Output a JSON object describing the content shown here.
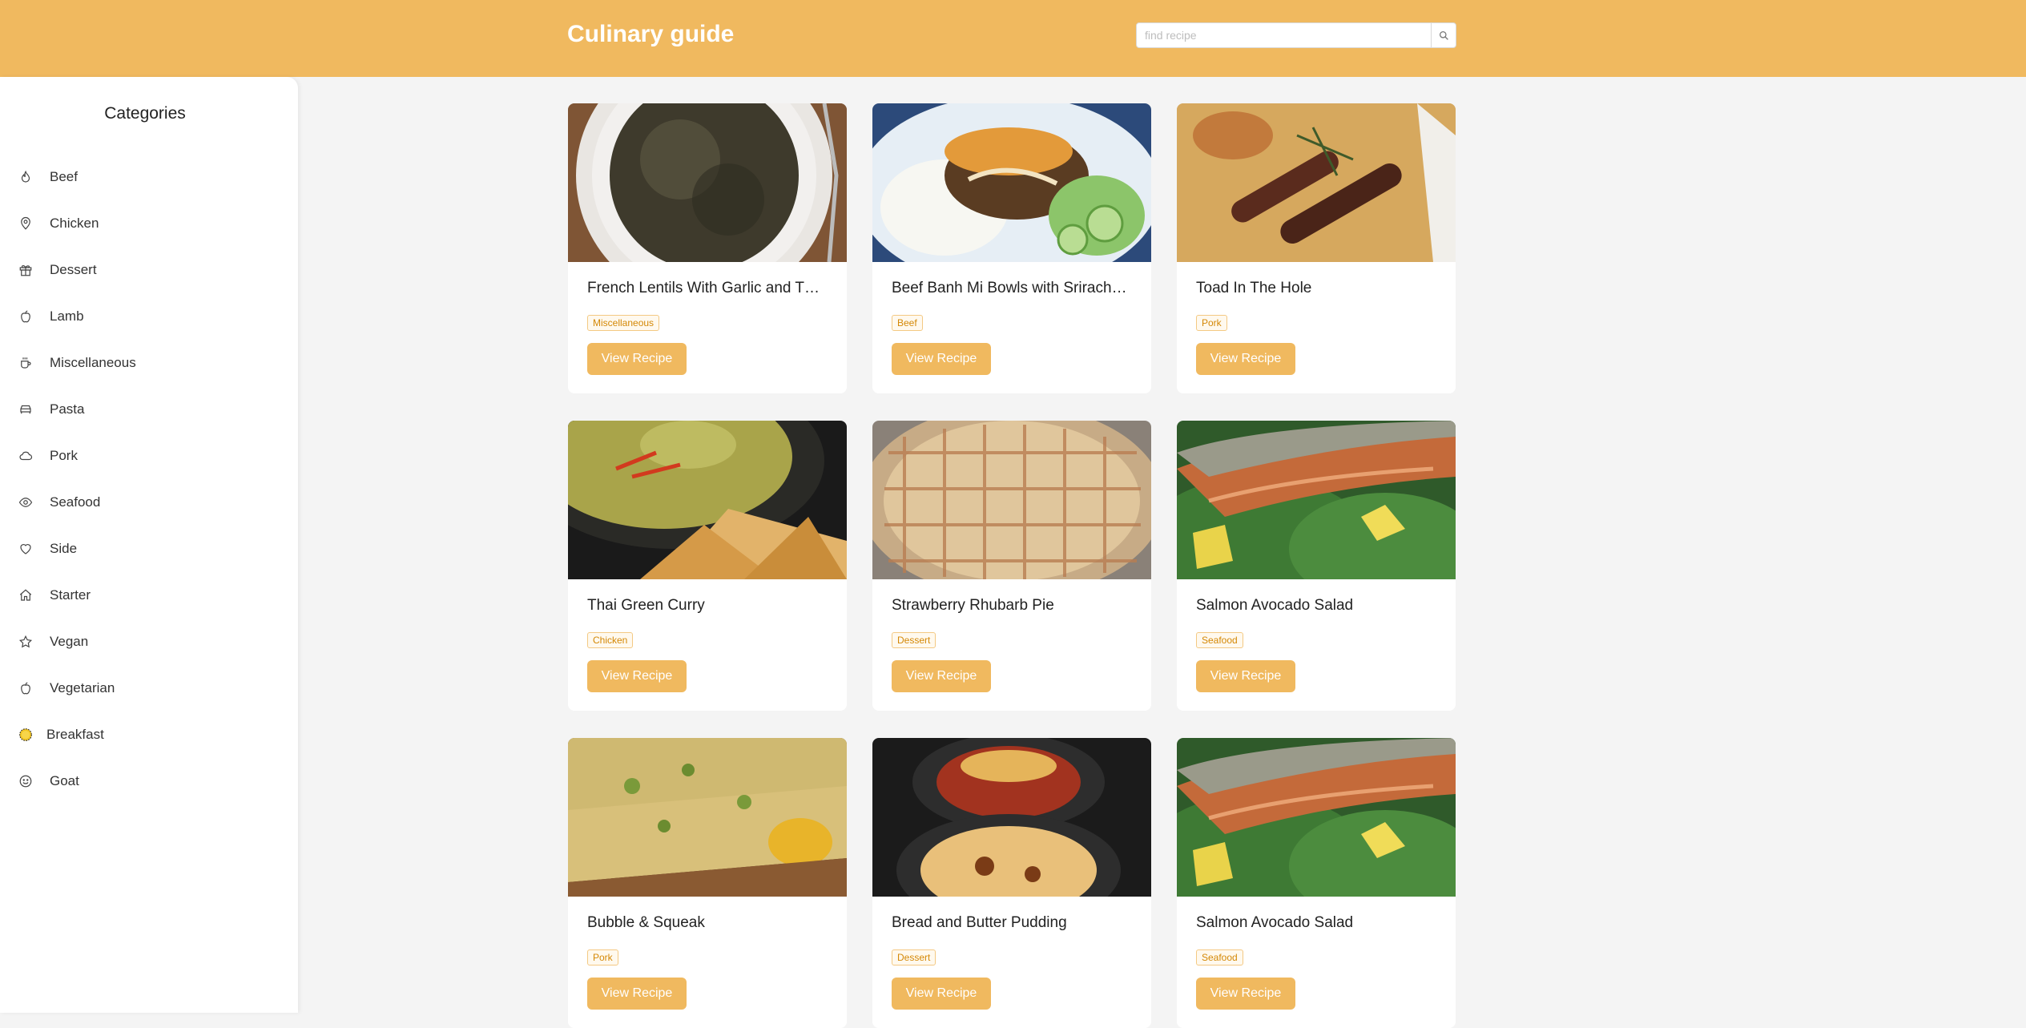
{
  "header": {
    "title": "Culinary guide"
  },
  "search": {
    "placeholder": "find recipe",
    "value": ""
  },
  "sidebar": {
    "title": "Categories",
    "items": [
      {
        "label": "Beef",
        "icon": "fire-icon"
      },
      {
        "label": "Chicken",
        "icon": "location-pin-icon"
      },
      {
        "label": "Dessert",
        "icon": "gift-icon"
      },
      {
        "label": "Lamb",
        "icon": "apple-icon"
      },
      {
        "label": "Miscellaneous",
        "icon": "coffee-cup-icon"
      },
      {
        "label": "Pasta",
        "icon": "car-icon"
      },
      {
        "label": "Pork",
        "icon": "cloud-icon"
      },
      {
        "label": "Seafood",
        "icon": "eye-icon"
      },
      {
        "label": "Side",
        "icon": "heart-icon"
      },
      {
        "label": "Starter",
        "icon": "home-icon"
      },
      {
        "label": "Vegan",
        "icon": "star-icon"
      },
      {
        "label": "Vegetarian",
        "icon": "apple-icon"
      },
      {
        "label": "Breakfast",
        "icon": "sun-icon"
      },
      {
        "label": "Goat",
        "icon": "smile-icon"
      }
    ]
  },
  "recipes": [
    {
      "name": "French Lentils With Garlic and Thyme",
      "tag": "Miscellaneous",
      "button": "View Recipe"
    },
    {
      "name": "Beef Banh Mi Bowls with Sriracha Mayo",
      "tag": "Beef",
      "button": "View Recipe"
    },
    {
      "name": "Toad In The Hole",
      "tag": "Pork",
      "button": "View Recipe"
    },
    {
      "name": "Thai Green Curry",
      "tag": "Chicken",
      "button": "View Recipe"
    },
    {
      "name": "Strawberry Rhubarb Pie",
      "tag": "Dessert",
      "button": "View Recipe"
    },
    {
      "name": "Salmon Avocado Salad",
      "tag": "Seafood",
      "button": "View Recipe"
    },
    {
      "name": "Bubble & Squeak",
      "tag": "Pork",
      "button": "View Recipe"
    },
    {
      "name": "Bread and Butter Pudding",
      "tag": "Dessert",
      "button": "View Recipe"
    },
    {
      "name": "Salmon Avocado Salad",
      "tag": "Seafood",
      "button": "View Recipe"
    }
  ],
  "colors": {
    "brand": "#f0b95f",
    "tag_text": "#d48806",
    "background": "#f4f4f4"
  }
}
